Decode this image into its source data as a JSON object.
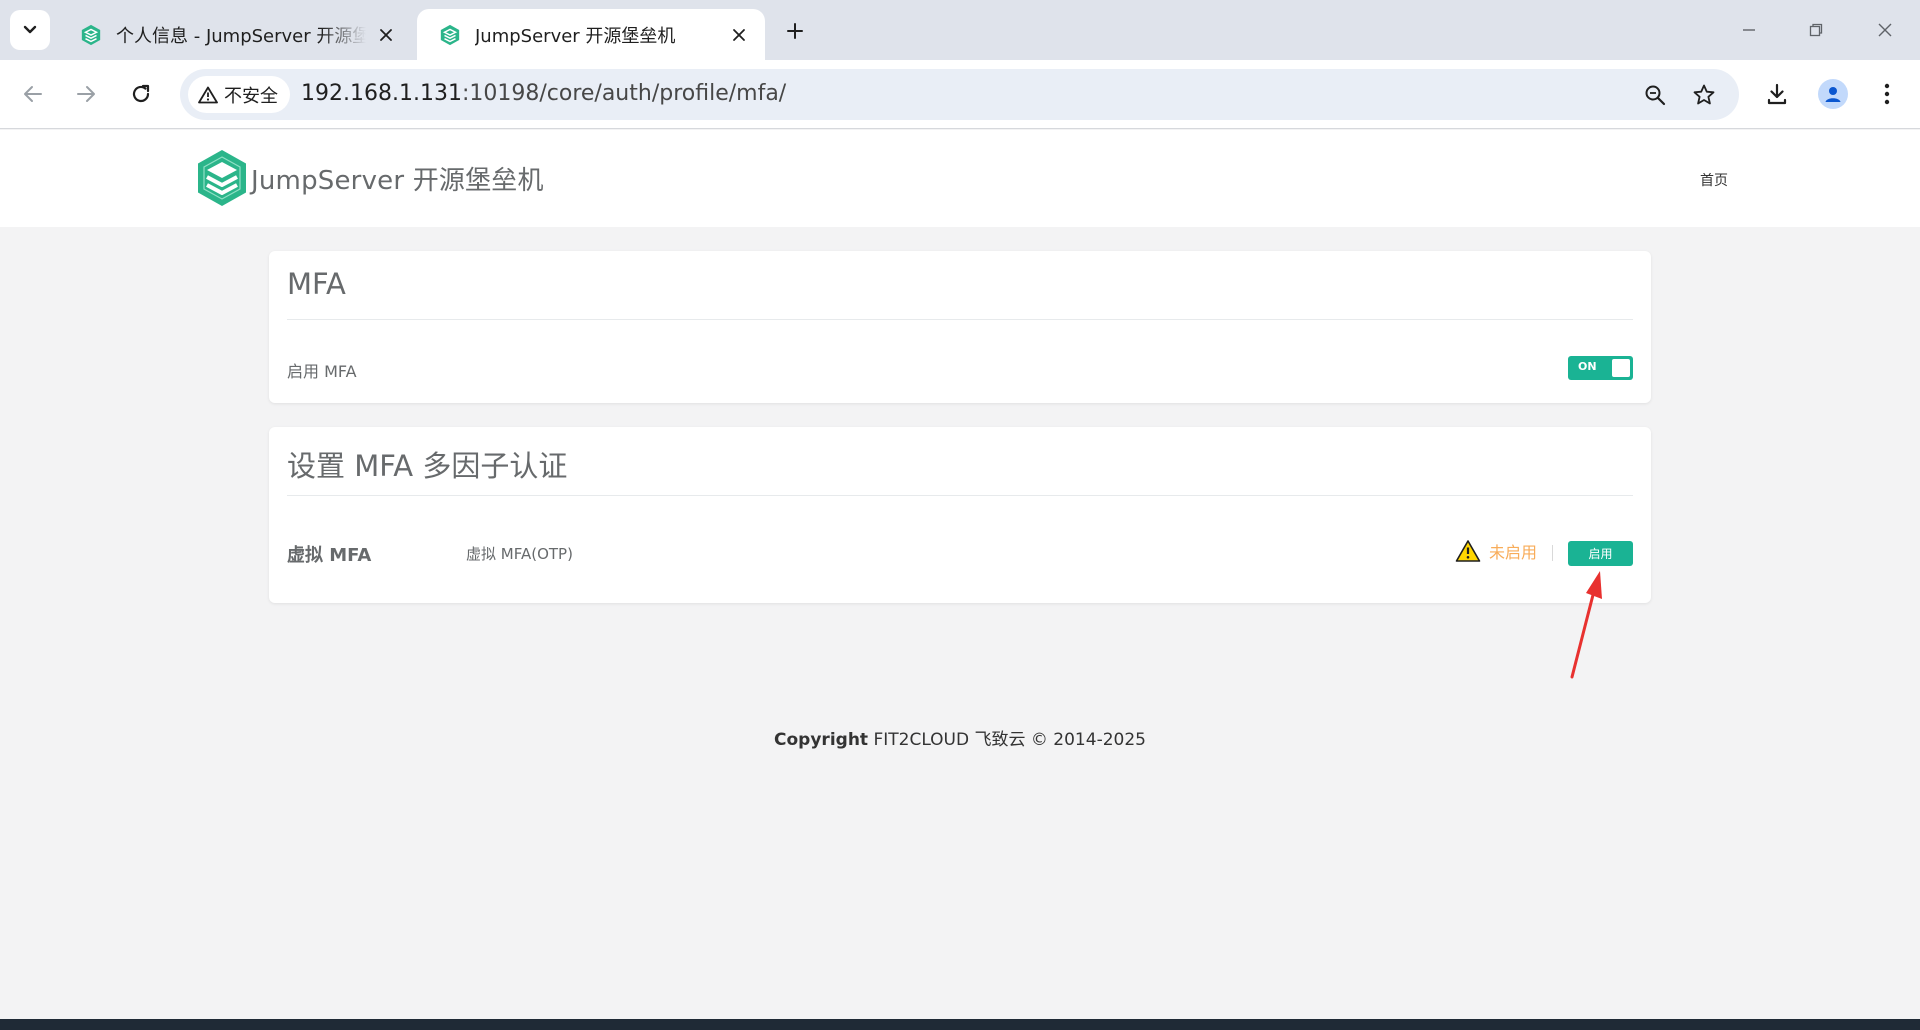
{
  "browser": {
    "tabs": [
      {
        "title": "个人信息 - JumpServer 开源堡",
        "active": false
      },
      {
        "title": "JumpServer 开源堡垒机",
        "active": true
      }
    ],
    "security_label": "不安全",
    "url_host": "192.168.1.131",
    "url_rest": ":10198/core/auth/profile/mfa/"
  },
  "header": {
    "brand": "JumpServer 开源堡垒机",
    "nav_home": "首页"
  },
  "mfa_card": {
    "title": "MFA",
    "enable_label": "启用 MFA",
    "switch_label": "ON"
  },
  "setup_card": {
    "title": "设置 MFA 多因子认证",
    "rows": [
      {
        "name": "虚拟 MFA",
        "description": "虚拟 MFA(OTP)",
        "status": "未启用",
        "action": "启用"
      }
    ]
  },
  "footer": {
    "copyright_bold": "Copyright",
    "copyright_text": " FIT2CLOUD 飞致云 © 2014-2025"
  },
  "colors": {
    "accent": "#1ab394",
    "warning": "#f8ac59",
    "annotation": "#e8312f"
  }
}
